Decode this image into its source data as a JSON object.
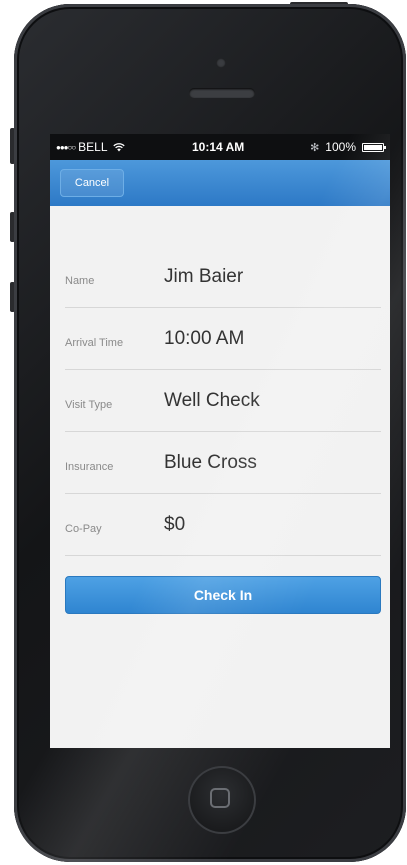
{
  "status_bar": {
    "signal": "●●●○○",
    "carrier": "BELL",
    "time": "10:14 AM",
    "bluetooth": "✻",
    "battery_percent": "100%"
  },
  "nav": {
    "cancel_label": "Cancel"
  },
  "form": {
    "fields": [
      {
        "label": "Name",
        "value": "Jim Baier"
      },
      {
        "label": "Arrival Time",
        "value": "10:00 AM"
      },
      {
        "label": "Visit Type",
        "value": "Well Check"
      },
      {
        "label": "Insurance",
        "value": "Blue Cross"
      },
      {
        "label": "Co-Pay",
        "value": "$0"
      }
    ]
  },
  "actions": {
    "check_in_label": "Check In"
  },
  "colors": {
    "accent": "#2d79c6",
    "nav_top": "#4d98db",
    "screen_background": "#f2f2f2",
    "phone_body": "#1d1e21"
  },
  "icons": {
    "wifi": "wifi-icon",
    "bluetooth": "bluetooth-icon",
    "battery": "battery-icon",
    "home": "home-button-icon"
  }
}
